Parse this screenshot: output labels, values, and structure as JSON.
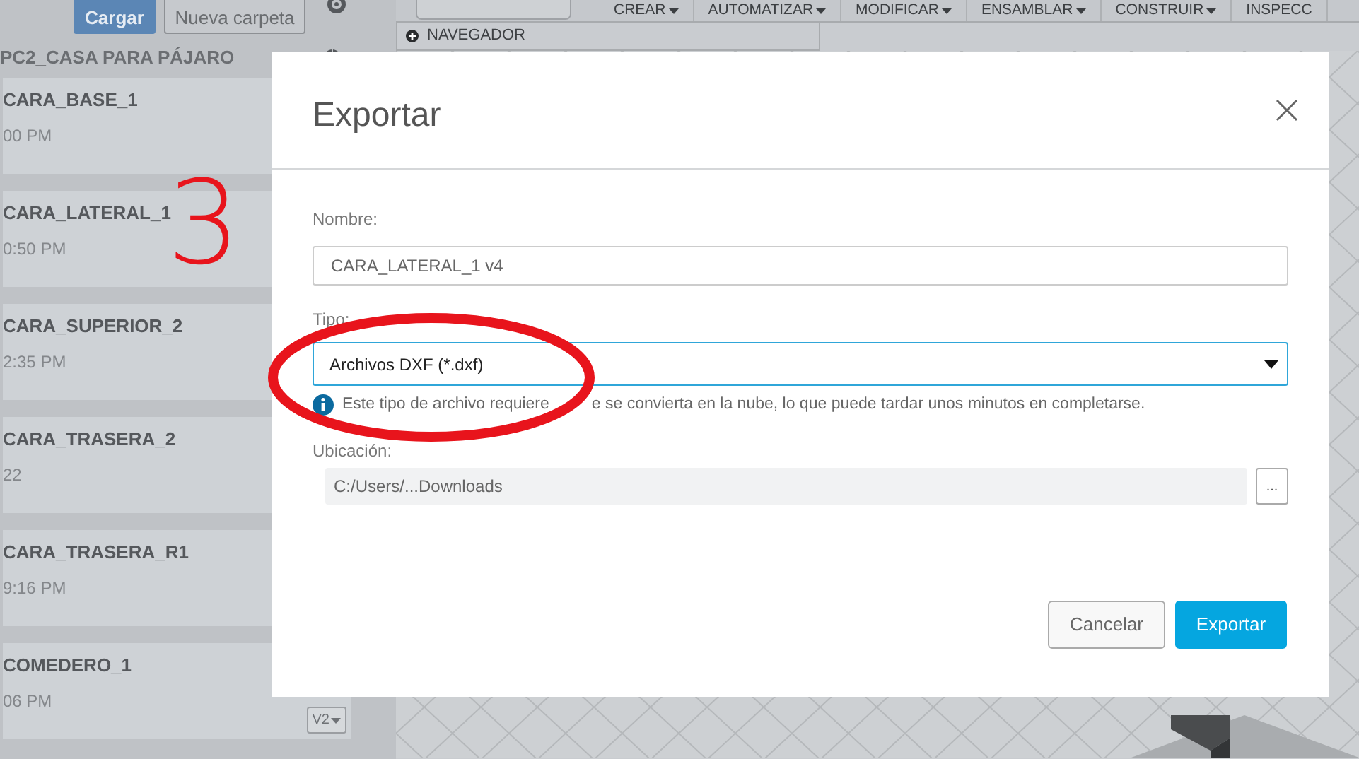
{
  "sidebar": {
    "upload_button": "Cargar",
    "new_folder_button": "Nueva carpeta",
    "project_title": "PC2_CASA PARA PÁJARO",
    "items": [
      {
        "name": "CARA_BASE_1",
        "time": "00 PM"
      },
      {
        "name": "CARA_LATERAL_1",
        "time": "0:50 PM"
      },
      {
        "name": "CARA_SUPERIOR_2",
        "time": "2:35 PM"
      },
      {
        "name": "CARA_TRASERA_2",
        "time": "22"
      },
      {
        "name": "CARA_TRASERA_R1",
        "time": "9:16 PM"
      },
      {
        "name": "COMEDERO_1",
        "time": "06 PM",
        "version": "V2"
      }
    ]
  },
  "toolbar": {
    "menus": [
      {
        "label": "CREAR",
        "caret": true
      },
      {
        "label": "AUTOMATIZAR",
        "caret": true
      },
      {
        "label": "MODIFICAR",
        "caret": true
      },
      {
        "label": "ENSAMBLAR",
        "caret": true
      },
      {
        "label": "CONSTRUIR",
        "caret": true
      },
      {
        "label": "INSPECC",
        "caret": false
      }
    ]
  },
  "browser_panel": {
    "title": "NAVEGADOR"
  },
  "dialog": {
    "title": "Exportar",
    "name_label": "Nombre:",
    "name_value": "CARA_LATERAL_1 v4",
    "type_label": "Tipo:",
    "type_value": "Archivos DXF (*.dxf)",
    "info": [
      "Este tipo de archivo requiere",
      "e se convierta en la nube, lo que puede tardar unos minutos en completarse."
    ],
    "location_label": "Ubicación:",
    "location_value": "C:/Users/...Downloads",
    "browse_button": "...",
    "buttons": [
      {
        "label": "Cancelar",
        "kind": "secondary"
      },
      {
        "label": "Exportar",
        "kind": "primary"
      }
    ]
  },
  "annotations": [
    {
      "kind": "number",
      "text": "3",
      "color": "#e8141c"
    },
    {
      "kind": "ellipse",
      "color": "#e8141c"
    }
  ]
}
